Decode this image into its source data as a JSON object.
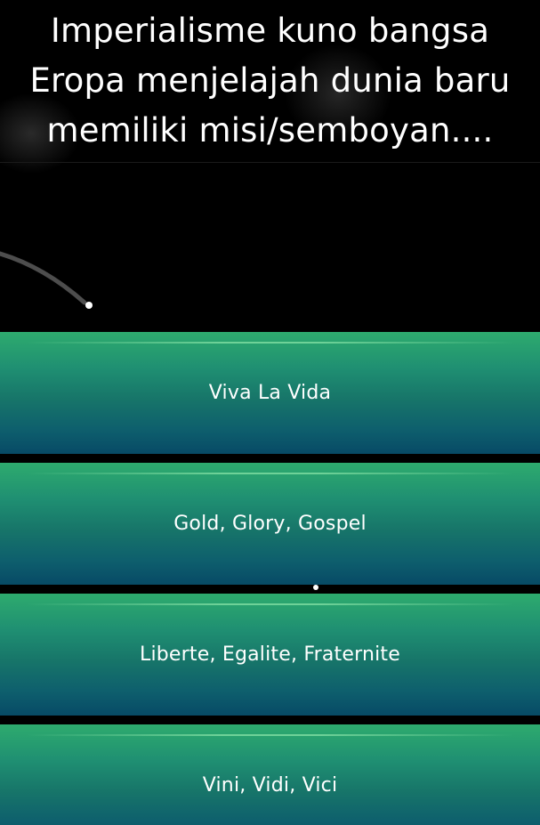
{
  "question": {
    "text": "Imperialisme kuno bangsa Eropa menjelajah dunia baru memiliki misi/semboyan...."
  },
  "answers": [
    {
      "label": "Viva La Vida"
    },
    {
      "label": "Gold, Glory, Gospel"
    },
    {
      "label": "Liberte, Egalite, Fraternite"
    },
    {
      "label": "Vini, Vidi, Vici"
    }
  ],
  "colors": {
    "background": "#000000",
    "answer_top": "#2eab6e",
    "answer_bottom": "#074a66",
    "text": "#ffffff"
  }
}
